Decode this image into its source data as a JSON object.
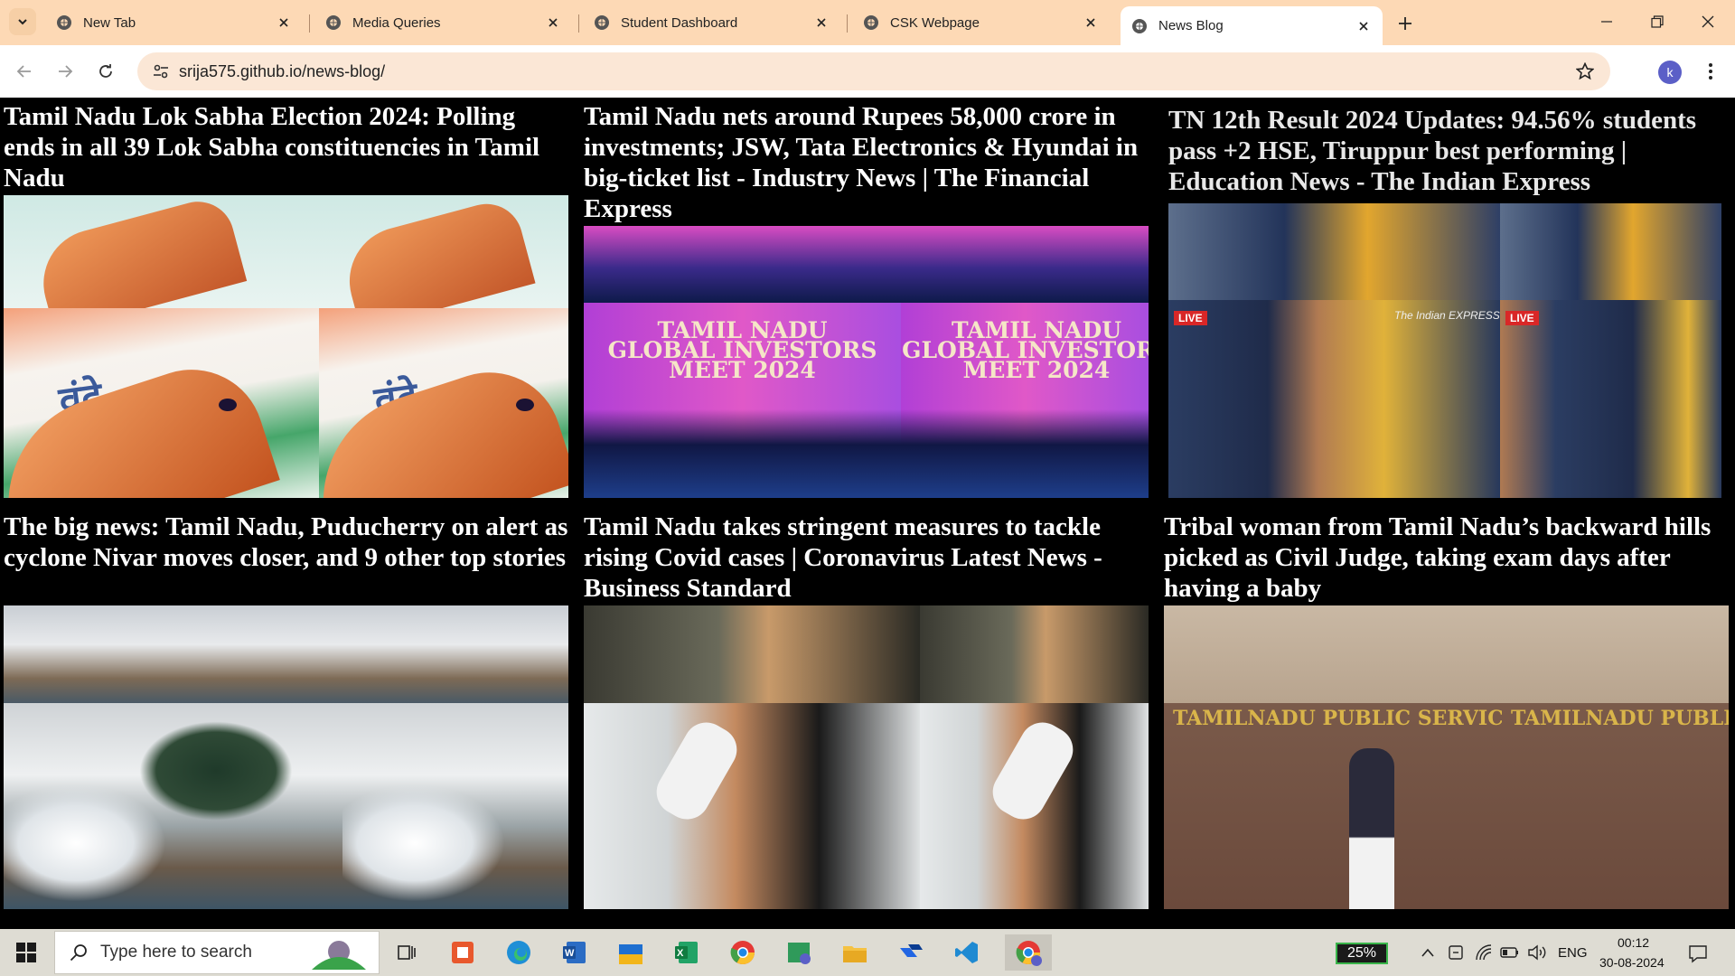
{
  "browser": {
    "tabs": [
      {
        "title": "New Tab",
        "active": false
      },
      {
        "title": "Media Queries",
        "active": false
      },
      {
        "title": "Student Dashboard",
        "active": false
      },
      {
        "title": "CSK Webpage",
        "active": false
      },
      {
        "title": "News Blog",
        "active": true
      }
    ],
    "url": "srija575.github.io/news-blog/",
    "profile_initial": "k"
  },
  "articles": [
    {
      "headline": "Tamil Nadu Lok Sabha Election 2024: Polling ends in all 39 Lok Sabha constituencies in Tamil Nadu",
      "image": "inked-finger-vande-mataram"
    },
    {
      "headline": "Tamil Nadu nets around Rupees 58,000 crore in investments; JSW, Tata Electronics & Hyundai in big-ticket list - Industry News | The Financial Express",
      "image": "global-investors-meet-stage",
      "image_text": [
        "TAMIL NADU",
        "GLOBAL INVESTORS",
        "MEET 2024"
      ]
    },
    {
      "headline": "TN 12th Result 2024 Updates: 94.56% students pass +2 HSE, Tiruppur best performing | Education News - The Indian Express",
      "image": "students-checking-results",
      "image_text": [
        "LIVE",
        "The Indian EXPRESS"
      ]
    },
    {
      "headline": "The big news: Tamil Nadu, Puducherry on alert as cyclone Nivar moves closer, and 9 other top stories",
      "image": "cyclone-waves-palm-trees"
    },
    {
      "headline": "Tamil Nadu takes stringent measures to tackle rising Covid cases | Coronavirus Latest News - Business Standard",
      "image": "covid-swab-test"
    },
    {
      "headline": "Tribal woman from Tamil Nadu’s backward hills picked as Civil Judge, taking exam days after having a baby",
      "image": "woman-holding-baby-tnpsc",
      "image_text": [
        "TAMILNADU PUBLIC SERVICE COMMISSION"
      ]
    }
  ],
  "taskbar": {
    "search_placeholder": "Type here to search",
    "battery_percent": "25%",
    "language": "ENG",
    "time": "00:12",
    "date": "30-08-2024"
  },
  "colors": {
    "tabstrip": "#fdd9b5",
    "omnibox": "#fbe7d6",
    "page_bg": "#000000",
    "headline": "#ffffff"
  }
}
